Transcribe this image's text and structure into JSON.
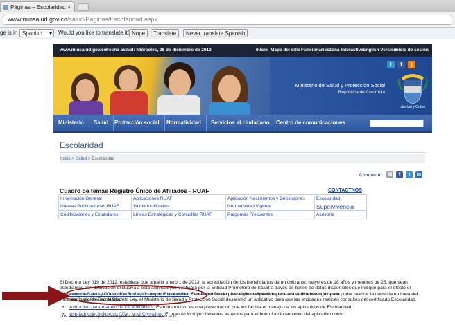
{
  "browser": {
    "tab_title": "Páginas – Escolaridad",
    "url_host": "www.minsalud.gov.co",
    "url_path": "/salud/Paginas/Escolaridad.aspx",
    "translate": {
      "prefix": "ge is in",
      "language": "Spanish",
      "question": "Would you like to translate it?",
      "nope": "Nope",
      "translate_btn": "Translate",
      "never": "Never translate Spanish"
    }
  },
  "topnav": {
    "site": "www.minsalud.gov.co",
    "date": "Fecha actual: Miércoles, 26 de diciembre de 2012",
    "links": [
      "Inicio",
      "Mapa del sitio",
      "Funcionarios",
      "Zona Interactiva",
      "English Version",
      "Inicio de sesión"
    ]
  },
  "banner": {
    "ministry": "Ministerio de Salud y Protección Social",
    "republic": "República de Colombia",
    "motto": "Libertad y Orden"
  },
  "mainnav": [
    "Ministerio",
    "Salud",
    "Protección social",
    "Normatividad",
    "Servicios al ciudadano",
    "Centro de comunicaciones"
  ],
  "page": {
    "title": "Escolaridad",
    "breadcrumb": {
      "home": "Inicio",
      "sep": " > ",
      "section": "Salud",
      "current": "Escolaridad"
    },
    "share_label": "Compartir",
    "cuadro_title": "Cuadro de temas  Registro Único de Afiliados - RUAF",
    "contactos": "CONTACTNOS",
    "grid": [
      [
        "Información General",
        "Aplicaciones RUAF",
        "Aplicación Nacimientos y Defunciones",
        "Escolaridad"
      ],
      [
        "Nuevas Publicaciones RUAF",
        "Validador Huellas",
        "Normatividad Vigente",
        "Supervivencia"
      ],
      [
        "Codificaciones y Estándares",
        "Líneas Estratégicas y Consultas RUAF",
        "Preguntas Frecuentes",
        "Asesoría"
      ]
    ],
    "para1": "El Decreto Ley 019 de 2012, establece que a partir enero 1 de 2013, la acreditación de los beneficiarios de un cotizante, mayores de 18 años y menores de 25, que sean estudiantes con dedicación exclusiva a esta actividad, se verificará por la Entidad Promotora de Salud a través de bases de datos disponibles que indique para el efecto el Ministerio de Salud y Protección Social, sin requerir la acreditación del certificado de estudios respectivos de cada entidad de educación.",
    "para2": "Para dar cumplimiento al Decreto Ley, el Ministerio de Salud y Protección Social desarrolló un aplicativo para que las entidades realicen consultas del certificado Escolaridad.",
    "para3": "Los Instrumentos que hacen parte de este aplicativo son:",
    "items": [
      {
        "link": "Instructivo para la Consulta del Certificado de Escolaridad:",
        "text": " Este instructivo explica el procedimiento que la entidad debe seguir para poder realizar la consulta en línea del certificado de Escolaridad."
      },
      {
        "link": "Instructivo para manejo de los aplicativos:",
        "text": " Este instructivo es una presentación que les facilita el manejo de los aplicativos de Escolaridad."
      },
      {
        "link": "Instalador del Aplicativo CDA Local Consultas:",
        "text": " El manual incluye diferentes aspectos para el buen funcionamiento del aplicativo como:"
      }
    ]
  },
  "colors": {
    "nav_dark": "#1d2433",
    "nav_blue": "#2d5aa2",
    "link": "#1f44a0",
    "annotation_red": "#8a1518"
  }
}
